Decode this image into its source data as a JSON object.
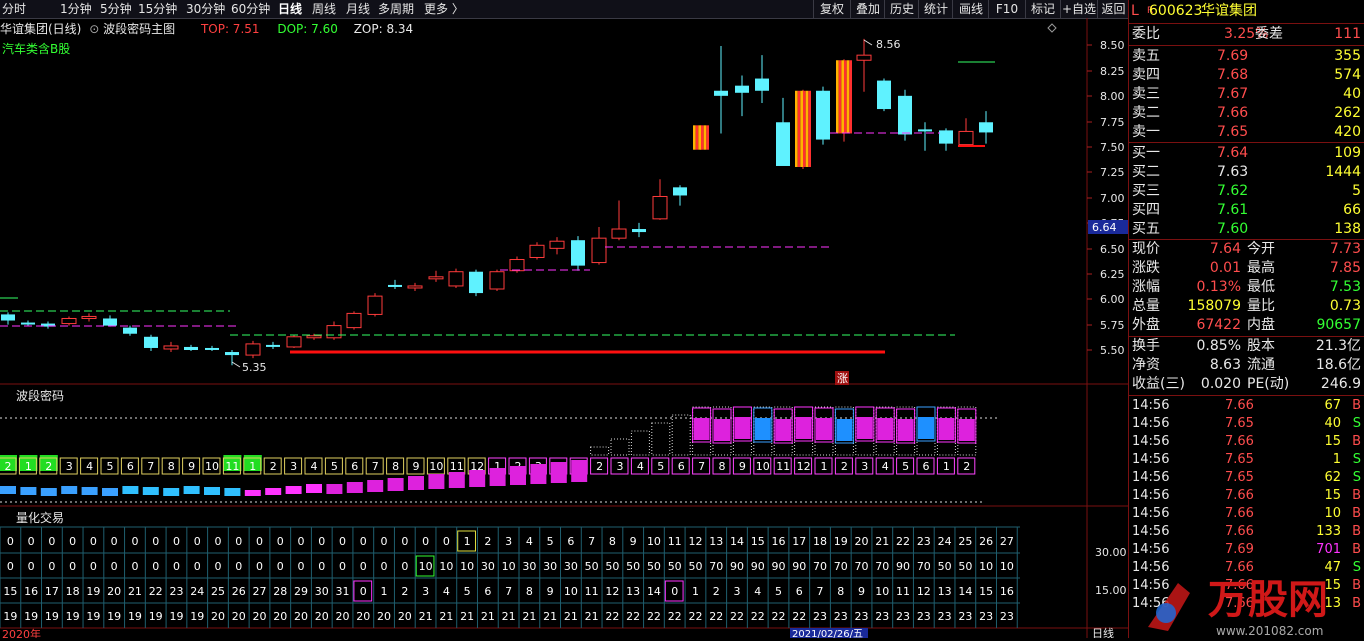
{
  "toolbar": {
    "left": [
      "分时",
      "1分钟",
      "5分钟",
      "15分钟",
      "30分钟",
      "60分钟",
      "日线",
      "周线",
      "月线",
      "多周期",
      "更多 〉"
    ],
    "right": [
      "复权",
      "叠加",
      "历史",
      "统计",
      "画线",
      "F10",
      "标记",
      "+自选",
      "返回"
    ]
  },
  "main": {
    "title": "华谊集团(日线)",
    "indicator": "波段密码主图",
    "top": "TOP: 7.51",
    "dop": "DOP: 7.60",
    "zop": "ZOP: 8.34",
    "sector": "汽车类含B股",
    "high_label": "8.56",
    "low_label": "5.35",
    "zhang": "涨",
    "current_price_tag": "6.64",
    "yaxis": [
      "8.50",
      "8.25",
      "8.00",
      "7.75",
      "7.50",
      "7.25",
      "7.00",
      "6.75",
      "6.50",
      "6.25",
      "6.00",
      "5.75",
      "5.50"
    ]
  },
  "panel2": {
    "title": "波段密码",
    "labels": [
      "2",
      "1",
      "2",
      "3",
      "4",
      "5",
      "6",
      "7",
      "8",
      "9",
      "10",
      "11",
      "1",
      "2",
      "3",
      "4",
      "5",
      "6",
      "7",
      "8",
      "9",
      "10",
      "11",
      "12",
      "1",
      "2",
      "3",
      "4",
      "1",
      "2",
      "3",
      "4",
      "5",
      "6",
      "7",
      "8",
      "9",
      "10",
      "11",
      "12",
      "1",
      "2",
      "3",
      "4",
      "5",
      "6",
      "1",
      "2"
    ]
  },
  "panel3": {
    "title": "量化交易",
    "row1": [
      "0",
      "0",
      "0",
      "0",
      "0",
      "0",
      "0",
      "0",
      "0",
      "0",
      "0",
      "0",
      "0",
      "0",
      "0",
      "0",
      "0",
      "0",
      "0",
      "0",
      "0",
      "0",
      "1",
      "2",
      "3",
      "4",
      "5",
      "6",
      "7",
      "8",
      "9",
      "10",
      "11",
      "12",
      "13",
      "14",
      "15",
      "16",
      "17",
      "18",
      "19",
      "20",
      "21",
      "22",
      "23",
      "24",
      "25",
      "26",
      "27"
    ],
    "row2": [
      "0",
      "0",
      "0",
      "0",
      "0",
      "0",
      "0",
      "0",
      "0",
      "0",
      "0",
      "0",
      "0",
      "0",
      "0",
      "0",
      "0",
      "0",
      "0",
      "0",
      "10",
      "10",
      "10",
      "30",
      "10",
      "30",
      "30",
      "30",
      "50",
      "50",
      "50",
      "50",
      "50",
      "50",
      "70",
      "90",
      "90",
      "90",
      "90",
      "70",
      "70",
      "70",
      "70",
      "90",
      "70",
      "50",
      "50",
      "10",
      "10"
    ],
    "row3": [
      "15",
      "16",
      "17",
      "18",
      "19",
      "20",
      "21",
      "22",
      "23",
      "24",
      "25",
      "26",
      "27",
      "28",
      "29",
      "30",
      "31",
      "0",
      "1",
      "2",
      "3",
      "4",
      "5",
      "6",
      "7",
      "8",
      "9",
      "10",
      "11",
      "12",
      "13",
      "14",
      "0",
      "1",
      "2",
      "3",
      "4",
      "5",
      "6",
      "7",
      "8",
      "9",
      "10",
      "11",
      "12",
      "13",
      "14",
      "15",
      "16"
    ],
    "row4": [
      "19",
      "19",
      "19",
      "19",
      "19",
      "19",
      "19",
      "19",
      "19",
      "19",
      "20",
      "20",
      "20",
      "20",
      "20",
      "20",
      "20",
      "20",
      "20",
      "20",
      "21",
      "21",
      "21",
      "21",
      "21",
      "21",
      "21",
      "21",
      "21",
      "22",
      "22",
      "22",
      "22",
      "22",
      "22",
      "22",
      "22",
      "22",
      "22",
      "23",
      "23",
      "23",
      "23",
      "23",
      "23",
      "23",
      "23",
      "23",
      "23"
    ],
    "yaxis": [
      "30.00",
      "15.00"
    ],
    "bottom_left": "2020年",
    "bottom_mid": "2021/02/26/五",
    "bottom_right": "日线"
  },
  "quote": {
    "code": "600623",
    "name": "华谊集团",
    "wei_bi_label": "委比",
    "wei_bi": "3.25%",
    "wei_cha_label": "委差",
    "wei_cha": "111",
    "sells": [
      {
        "label": "卖五",
        "price": "7.69",
        "vol": "355"
      },
      {
        "label": "卖四",
        "price": "7.68",
        "vol": "574"
      },
      {
        "label": "卖三",
        "price": "7.67",
        "vol": "40"
      },
      {
        "label": "卖二",
        "price": "7.66",
        "vol": "262"
      },
      {
        "label": "卖一",
        "price": "7.65",
        "vol": "420"
      }
    ],
    "buys": [
      {
        "label": "买一",
        "price": "7.64",
        "vol": "109"
      },
      {
        "label": "买二",
        "price": "7.63",
        "vol": "1444"
      },
      {
        "label": "买三",
        "price": "7.62",
        "vol": "5"
      },
      {
        "label": "买四",
        "price": "7.61",
        "vol": "66"
      },
      {
        "label": "买五",
        "price": "7.60",
        "vol": "138"
      }
    ],
    "stats": [
      {
        "l1": "现价",
        "v1": "7.64",
        "l2": "今开",
        "v2": "7.73"
      },
      {
        "l1": "涨跌",
        "v1": "0.01",
        "l2": "最高",
        "v2": "7.85"
      },
      {
        "l1": "涨幅",
        "v1": "0.13%",
        "l2": "最低",
        "v2": "7.53"
      },
      {
        "l1": "总量",
        "v1": "158079",
        "l2": "量比",
        "v2": "0.73"
      },
      {
        "l1": "外盘",
        "v1": "67422",
        "l2": "内盘",
        "v2": "90657"
      }
    ],
    "stats2": [
      {
        "l1": "换手",
        "v1": "0.85%",
        "l2": "股本",
        "v2": "21.3亿"
      },
      {
        "l1": "净资",
        "v1": "8.63",
        "l2": "流通",
        "v2": "18.6亿"
      },
      {
        "l1": "收益(三)",
        "v1": "0.020",
        "l2": "PE(动)",
        "v2": "246.9"
      }
    ],
    "ticks": [
      {
        "t": "14:56",
        "p": "7.66",
        "v": "67",
        "s": "B"
      },
      {
        "t": "14:56",
        "p": "7.65",
        "v": "40",
        "s": "S"
      },
      {
        "t": "14:56",
        "p": "7.66",
        "v": "15",
        "s": "B"
      },
      {
        "t": "14:56",
        "p": "7.65",
        "v": "1",
        "s": "S"
      },
      {
        "t": "14:56",
        "p": "7.65",
        "v": "62",
        "s": "S"
      },
      {
        "t": "14:56",
        "p": "7.66",
        "v": "15",
        "s": "B"
      },
      {
        "t": "14:56",
        "p": "7.66",
        "v": "10",
        "s": "B"
      },
      {
        "t": "14:56",
        "p": "7.66",
        "v": "133",
        "s": "B"
      },
      {
        "t": "14:56",
        "p": "7.69",
        "v": "701",
        "s": "B"
      },
      {
        "t": "14:56",
        "p": "7.66",
        "v": "47",
        "s": "S"
      },
      {
        "t": "14:56",
        "p": "7.66",
        "v": "15",
        "s": "B"
      },
      {
        "t": "14:56",
        "p": "7.66",
        "v": "13",
        "s": "B"
      }
    ],
    "watermark": "万股网",
    "watermark_url": "www.201082.com"
  }
}
